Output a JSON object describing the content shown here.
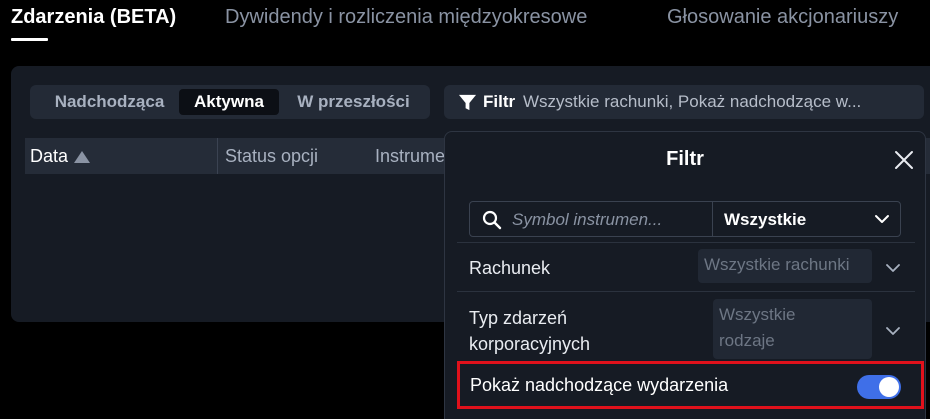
{
  "top_tabs": [
    {
      "label": "Zdarzenia (BETA)",
      "active": true
    },
    {
      "label": "Dywidendy i rozliczenia międzyokresowe",
      "active": false
    },
    {
      "label": "Głosowanie akcjonariuszy",
      "active": false
    }
  ],
  "segments": [
    {
      "label": "Nadchodząca",
      "active": false
    },
    {
      "label": "Aktywna",
      "active": true
    },
    {
      "label": "W przeszłości",
      "active": false
    }
  ],
  "filter_bar": {
    "label": "Filtr",
    "value": "Wszystkie rachunki, Pokaż nadchodzące w...",
    "icon": "funnel-icon"
  },
  "table": {
    "columns": [
      "Data",
      "Status opcji",
      "Instrume"
    ],
    "sort_icon": "sort-ascending-icon"
  },
  "popover": {
    "title": "Filtr",
    "close_icon": "close-icon",
    "search": {
      "placeholder": "Symbol instrumen...",
      "icon": "search-icon"
    },
    "type_select": {
      "value": "Wszystkie"
    },
    "account": {
      "label": "Rachunek",
      "value": "Wszystkie rachunki"
    },
    "event_type": {
      "label_line1": "Typ zdarzeń",
      "label_line2": "korporacyjnych",
      "value_line1": "Wszystkie",
      "value_line2": "rodzaje"
    },
    "show_upcoming": {
      "label": "Pokaż nadchodzące wydarzenia",
      "enabled": true
    }
  },
  "colors": {
    "background": "#000000",
    "panel": "#161b24",
    "accent_toggle": "#3f6fe8",
    "highlight_border": "#e0111b"
  }
}
